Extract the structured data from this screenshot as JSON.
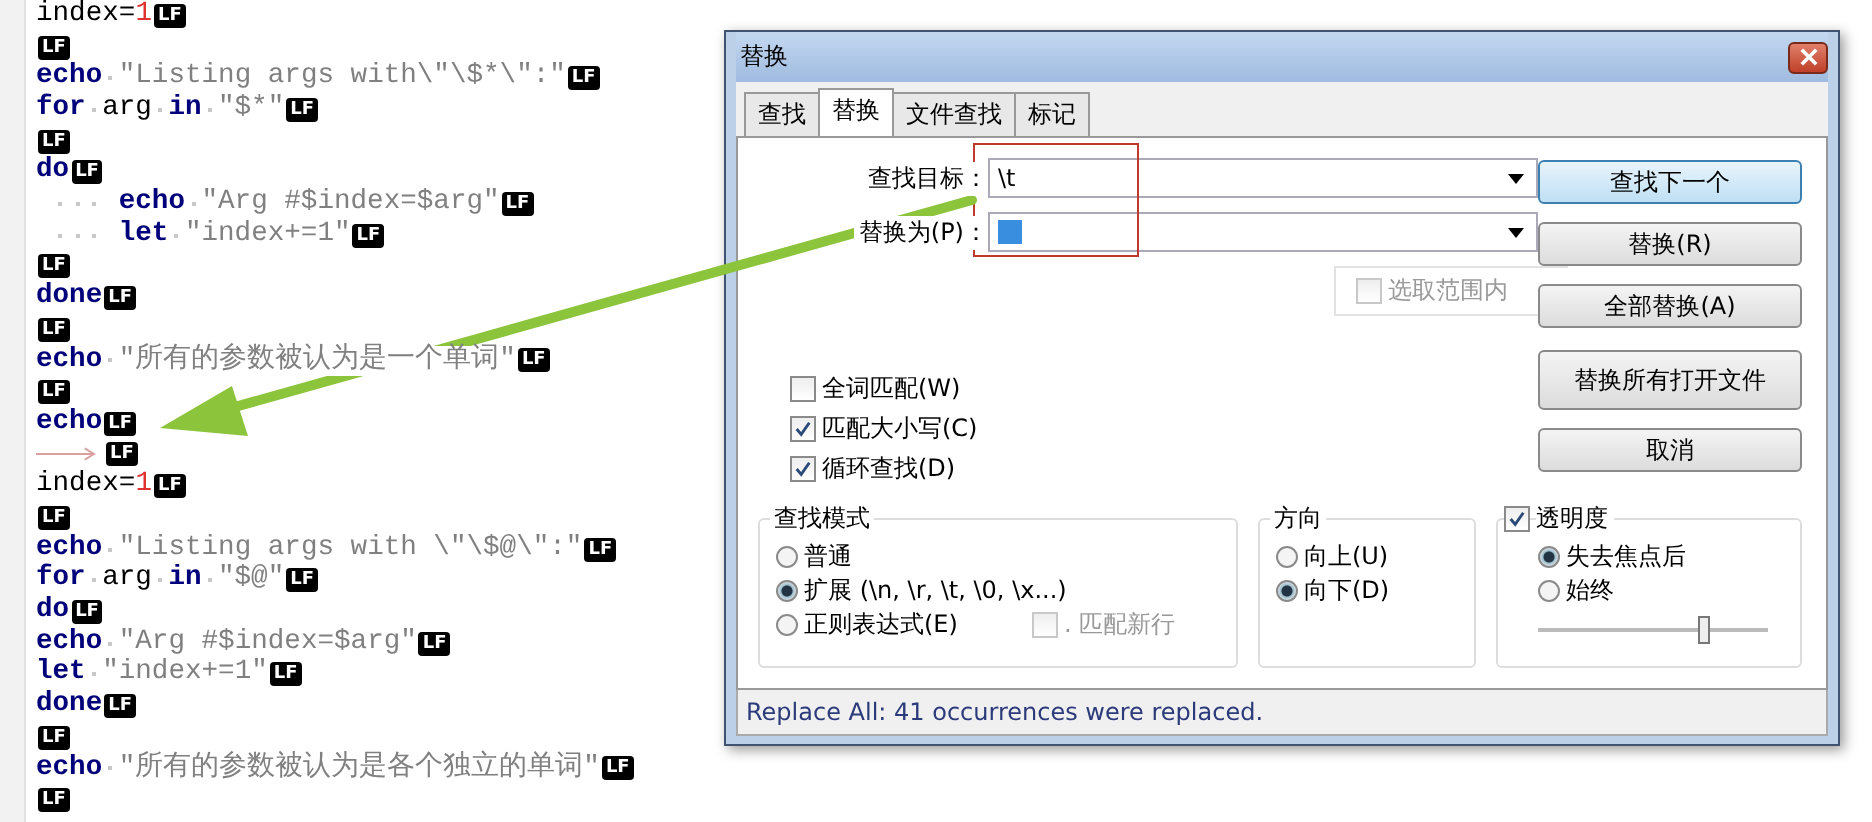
{
  "editor": {
    "lines": [
      {
        "tokens": [
          {
            "kind": "plain",
            "text": "index="
          },
          {
            "kind": "number",
            "text": "1"
          }
        ],
        "eol": "LF"
      },
      {
        "eol": "LF"
      },
      {
        "tokens": [
          {
            "kind": "keyword",
            "text": "echo"
          },
          {
            "kind": "space"
          },
          {
            "kind": "string",
            "text": "\"Listing args with\\\"\\$*\\\":\""
          }
        ],
        "eol": "LF"
      },
      {
        "tokens": [
          {
            "kind": "keyword",
            "text": "for"
          },
          {
            "kind": "space"
          },
          {
            "kind": "plain",
            "text": "arg"
          },
          {
            "kind": "space"
          },
          {
            "kind": "keyword",
            "text": "in"
          },
          {
            "kind": "space"
          },
          {
            "kind": "string",
            "text": "\"$*\""
          }
        ],
        "eol": "LF"
      },
      {
        "eol": "LF"
      },
      {
        "tokens": [
          {
            "kind": "keyword",
            "text": "do"
          }
        ],
        "eol": "LF"
      },
      {
        "tokens": [
          {
            "kind": "indent"
          },
          {
            "kind": "keyword",
            "text": "echo"
          },
          {
            "kind": "space"
          },
          {
            "kind": "string",
            "text": "\"Arg #$index=$arg\""
          }
        ],
        "eol": "LF"
      },
      {
        "tokens": [
          {
            "kind": "indent"
          },
          {
            "kind": "keyword",
            "text": "let"
          },
          {
            "kind": "space"
          },
          {
            "kind": "string",
            "text": "\"index+=1\""
          }
        ],
        "eol": "LF"
      },
      {
        "eol": "LF"
      },
      {
        "tokens": [
          {
            "kind": "keyword",
            "text": "done"
          }
        ],
        "eol": "LF"
      },
      {
        "eol": "LF"
      },
      {
        "tokens": [
          {
            "kind": "keyword",
            "text": "echo"
          },
          {
            "kind": "space"
          },
          {
            "kind": "string",
            "text": "\"所有的参数被认为是一个单词\""
          }
        ],
        "eol": "LF"
      },
      {
        "eol": "LF"
      },
      {
        "tokens": [
          {
            "kind": "keyword",
            "text": "echo"
          }
        ],
        "eol": "LF"
      },
      {
        "tokens": [
          {
            "kind": "tab"
          }
        ],
        "eol": "LF"
      },
      {
        "tokens": [
          {
            "kind": "plain",
            "text": "index="
          },
          {
            "kind": "number",
            "text": "1"
          }
        ],
        "eol": "LF"
      },
      {
        "eol": "LF"
      },
      {
        "tokens": [
          {
            "kind": "keyword",
            "text": "echo"
          },
          {
            "kind": "space"
          },
          {
            "kind": "string",
            "text": "\"Listing args with \\\"\\$@\\\":\""
          }
        ],
        "eol": "LF"
      },
      {
        "tokens": [
          {
            "kind": "keyword",
            "text": "for"
          },
          {
            "kind": "space"
          },
          {
            "kind": "plain",
            "text": "arg"
          },
          {
            "kind": "space"
          },
          {
            "kind": "keyword",
            "text": "in"
          },
          {
            "kind": "space"
          },
          {
            "kind": "string",
            "text": "\"$@\""
          }
        ],
        "eol": "LF"
      },
      {
        "tokens": [
          {
            "kind": "keyword",
            "text": "do"
          }
        ],
        "eol": "LF"
      },
      {
        "tokens": [
          {
            "kind": "keyword",
            "text": "echo"
          },
          {
            "kind": "space"
          },
          {
            "kind": "string",
            "text": "\"Arg #$index=$arg\""
          }
        ],
        "eol": "LF"
      },
      {
        "tokens": [
          {
            "kind": "keyword",
            "text": "let"
          },
          {
            "kind": "space"
          },
          {
            "kind": "string",
            "text": "\"index+=1\""
          }
        ],
        "eol": "LF"
      },
      {
        "tokens": [
          {
            "kind": "keyword",
            "text": "done"
          }
        ],
        "eol": "LF"
      },
      {
        "eol": "LF"
      },
      {
        "tokens": [
          {
            "kind": "keyword",
            "text": "echo"
          },
          {
            "kind": "space"
          },
          {
            "kind": "string",
            "text": "\"所有的参数被认为是各个独立的单词\""
          }
        ],
        "eol": "LF"
      },
      {
        "eol": "LF"
      }
    ]
  },
  "dialog": {
    "title": "替换",
    "tabs": [
      {
        "label": "查找",
        "selected": false
      },
      {
        "label": "替换",
        "selected": true
      },
      {
        "label": "文件查找",
        "selected": false
      },
      {
        "label": "标记",
        "selected": false
      }
    ],
    "fields": [
      {
        "label": "查找目标：",
        "value": "\\t",
        "has_selection": false
      },
      {
        "label": "替换为(P)：",
        "has_selection": true
      }
    ],
    "in_selection": {
      "label": "选取范围内",
      "checked": false,
      "disabled": true
    },
    "buttons": [
      {
        "label": "查找下一个",
        "default": true
      },
      {
        "label": "替换(R)",
        "default": false
      },
      {
        "label": "全部替换(A)",
        "default": false
      },
      {
        "label": "替换所有打开文件",
        "default": false
      },
      {
        "label": "取消",
        "default": false
      }
    ],
    "options": [
      {
        "label": "全词匹配(W)",
        "checked": false
      },
      {
        "label": "匹配大小写(C)",
        "checked": true
      },
      {
        "label": "循环查找(D)",
        "checked": true
      }
    ],
    "search_mode": {
      "title": "查找模式",
      "options": [
        {
          "label": "普通",
          "selected": false
        },
        {
          "label": "扩展 (\\n, \\r, \\t, \\0, \\x...)",
          "selected": true
        },
        {
          "label": "正则表达式(E)",
          "selected": false
        }
      ],
      "dot_newline": {
        "label": ". 匹配新行",
        "checked": false,
        "disabled": true
      }
    },
    "direction": {
      "title": "方向",
      "options": [
        {
          "label": "向上(U)",
          "selected": false
        },
        {
          "label": "向下(D)",
          "selected": true
        }
      ]
    },
    "transparency": {
      "label": "透明度",
      "checked": true,
      "options": [
        {
          "label": "失去焦点后",
          "selected": true
        },
        {
          "label": "始终",
          "selected": false
        }
      ],
      "level": 0.72
    },
    "status": "Replace All: 41 occurrences were replaced."
  }
}
